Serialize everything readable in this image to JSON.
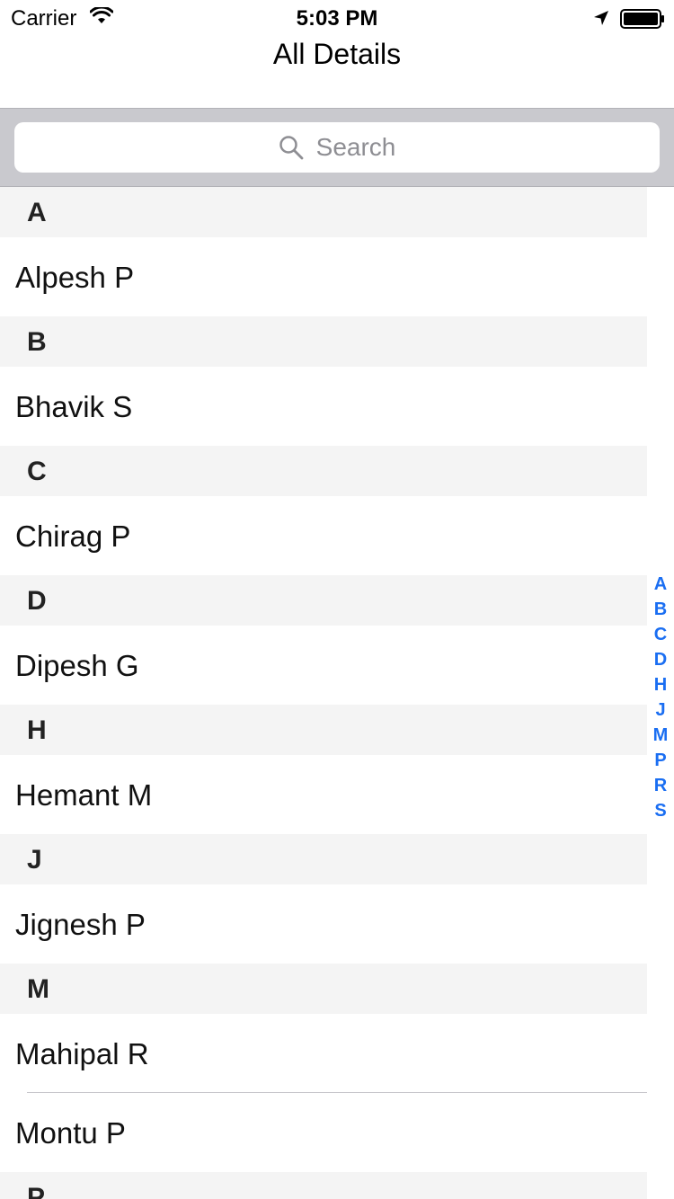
{
  "status": {
    "carrier": "Carrier",
    "time": "5:03 PM"
  },
  "nav": {
    "title": "All Details"
  },
  "search": {
    "placeholder": "Search"
  },
  "sections": [
    {
      "letter": "A",
      "rows": [
        "Alpesh P"
      ]
    },
    {
      "letter": "B",
      "rows": [
        "Bhavik S"
      ]
    },
    {
      "letter": "C",
      "rows": [
        "Chirag P"
      ]
    },
    {
      "letter": "D",
      "rows": [
        "Dipesh G"
      ]
    },
    {
      "letter": "H",
      "rows": [
        "Hemant M"
      ]
    },
    {
      "letter": "J",
      "rows": [
        "Jignesh P"
      ]
    },
    {
      "letter": "M",
      "rows": [
        "Mahipal R",
        "Montu P"
      ]
    },
    {
      "letter": "P",
      "rows": []
    }
  ],
  "index": [
    "A",
    "B",
    "C",
    "D",
    "H",
    "J",
    "M",
    "P",
    "R",
    "S"
  ],
  "colors": {
    "accent": "#1a6ef2",
    "search_bar_bg": "#c9c9ce",
    "section_header_bg": "#f4f4f4"
  },
  "icons": {
    "status": [
      "wifi-icon",
      "location-icon",
      "battery-icon"
    ],
    "search": "search-icon"
  }
}
